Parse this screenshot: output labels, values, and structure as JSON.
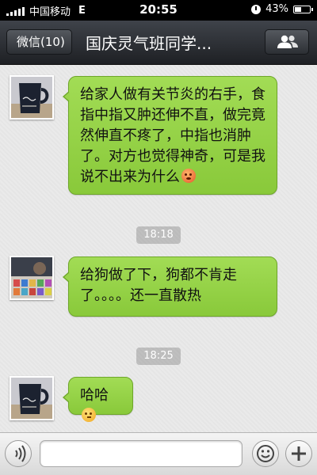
{
  "status_bar": {
    "carrier": "中国移动",
    "network": "E",
    "time": "20:55",
    "battery": "43%"
  },
  "nav": {
    "back_label": "微信(10)",
    "title": "国庆灵气班同学..."
  },
  "messages": [
    {
      "text": "给家人做有关节炎的右手，食指中指又肿还伸不直，做完竟然伸直不疼了，中指也消肿了。对方也觉得神奇，可是我说不出来为什么",
      "emoji": "face-icon"
    },
    {
      "text": "给狗做了下，狗都不肯走了。。。。还一直散热"
    },
    {
      "text": "哈哈",
      "emoji": "thinking-face-icon"
    }
  ],
  "timestamps": [
    "18:18",
    "18:25"
  ],
  "input": {
    "value": "",
    "placeholder": ""
  },
  "colors": {
    "bubble": "#9ad44e",
    "nav": "#2c2f34",
    "chat_bg": "#e9e9e9"
  }
}
